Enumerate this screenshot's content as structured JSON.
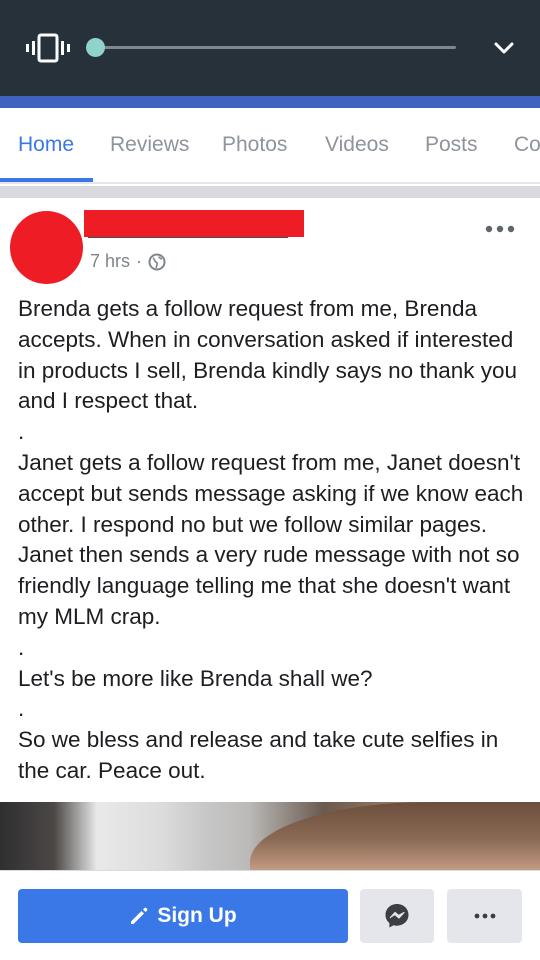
{
  "media_bar": {
    "progress": 0.0,
    "colors": {
      "background": "#27313a",
      "accent": "#8fd3cc"
    },
    "icons": [
      "vibrate-icon",
      "chevron-down-icon"
    ]
  },
  "tabs": [
    {
      "label": "Home",
      "active": true
    },
    {
      "label": "Reviews",
      "active": false
    },
    {
      "label": "Photos",
      "active": false
    },
    {
      "label": "Videos",
      "active": false
    },
    {
      "label": "Posts",
      "active": false
    },
    {
      "label": "Co",
      "active": false
    }
  ],
  "post": {
    "time": "7 hrs",
    "separator": "·",
    "privacy_icon": "globe-icon",
    "paragraphs": [
      "Brenda gets a follow request from me, Brenda accepts. When in conversation asked if interested in products I sell, Brenda kindly says no thank you and I respect that.",
      ".",
      "Janet gets a follow request from me, Janet doesn't accept but sends message asking if we know each other. I respond no but we follow similar pages. Janet then sends a very rude message with not so friendly language telling me that she doesn't want my MLM crap.",
      ".",
      "Let's be more like Brenda shall we?",
      ".",
      "So we bless and release and take cute selfies in the car. Peace out."
    ]
  },
  "bottom_bar": {
    "signup_label": "Sign Up",
    "colors": {
      "primary": "#3b78e7",
      "secondary": "#e4e6eb"
    }
  }
}
